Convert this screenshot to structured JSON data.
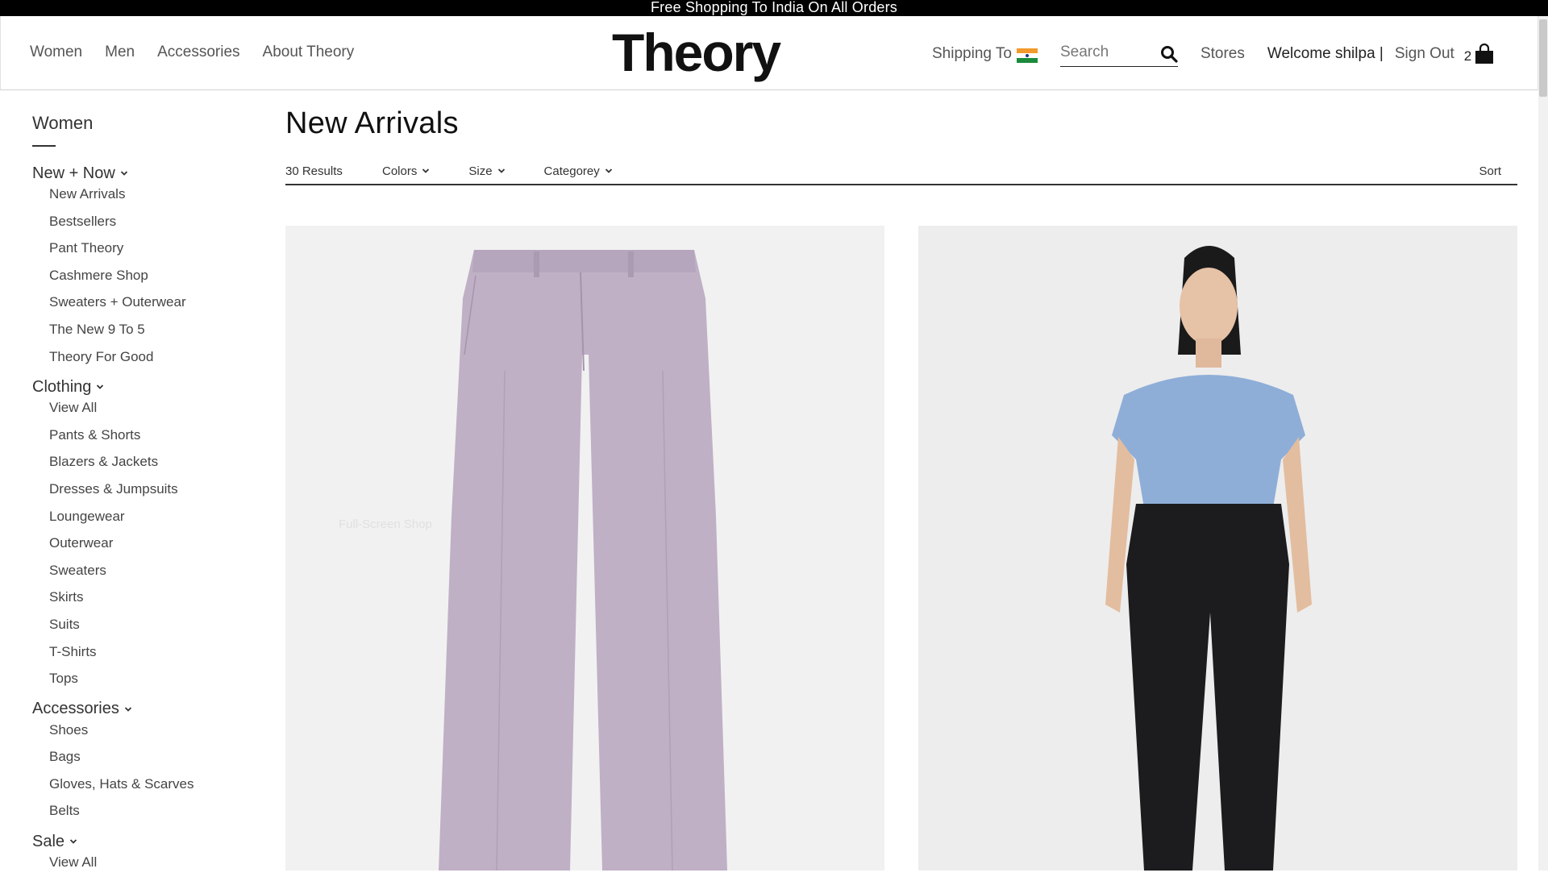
{
  "promo": {
    "text": "Free Shopping To India On All Orders"
  },
  "header": {
    "nav": [
      "Women",
      "Men",
      "Accessories",
      "About Theory"
    ],
    "logo": "Theory",
    "shipping_label": "Shipping To",
    "search_placeholder": "Search",
    "stores": "Stores",
    "welcome": "Welcome shilpa |",
    "sign_out": "Sign Out",
    "cart_count": "2"
  },
  "sidebar": {
    "title": "Women",
    "sections": [
      {
        "label": "New + Now",
        "items": [
          "New Arrivals",
          "Bestsellers",
          "Pant Theory",
          "Cashmere Shop",
          "Sweaters + Outerwear",
          "The New 9 To 5",
          "Theory For Good"
        ]
      },
      {
        "label": "Clothing",
        "items": [
          "View All",
          "Pants & Shorts",
          "Blazers & Jackets",
          "Dresses & Jumpsuits",
          "Loungewear",
          "Outerwear",
          "Sweaters",
          "Skirts",
          "Suits",
          "T-Shirts",
          "Tops"
        ]
      },
      {
        "label": "Accessories",
        "items": [
          "Shoes",
          "Bags",
          "Gloves, Hats & Scarves",
          "Belts"
        ]
      },
      {
        "label": "Sale",
        "items": [
          "View All"
        ]
      }
    ]
  },
  "main": {
    "title": "New Arrivals",
    "results": "30 Results",
    "filters": [
      "Colors",
      "Size",
      "Categorey"
    ],
    "sort": "Sort",
    "card_overlay": "Full-Screen Shop"
  },
  "colors": {
    "pants": "#bfb0c6",
    "tshirt": "#8eaed8",
    "leggings": "#1c1c1e"
  }
}
